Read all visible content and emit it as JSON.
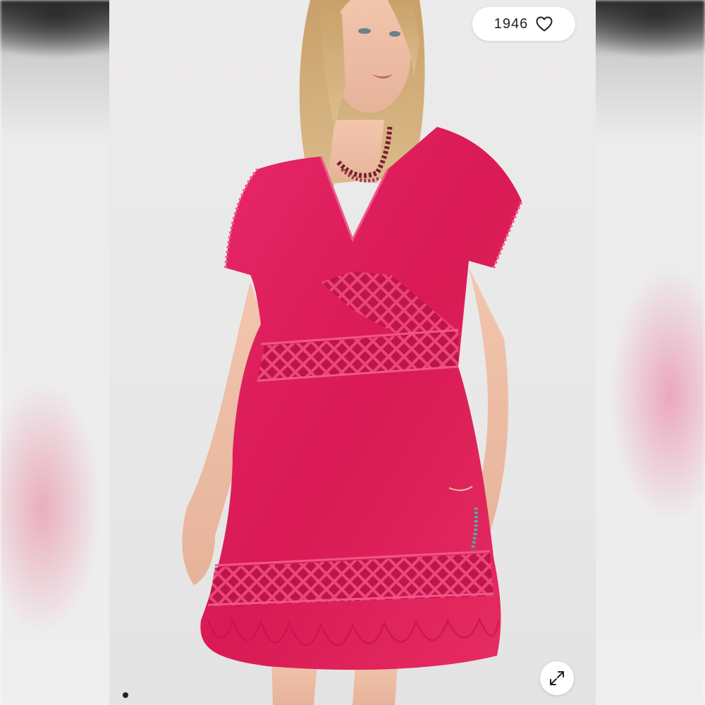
{
  "listing": {
    "likes": "1946",
    "icons": {
      "like": "heart-outline-icon",
      "expand": "expand-arrows-icon"
    },
    "pager": {
      "current": 1
    },
    "colors": {
      "dress": "#e0205a",
      "backdrop": "#ececec",
      "pill": "#ffffff"
    }
  }
}
